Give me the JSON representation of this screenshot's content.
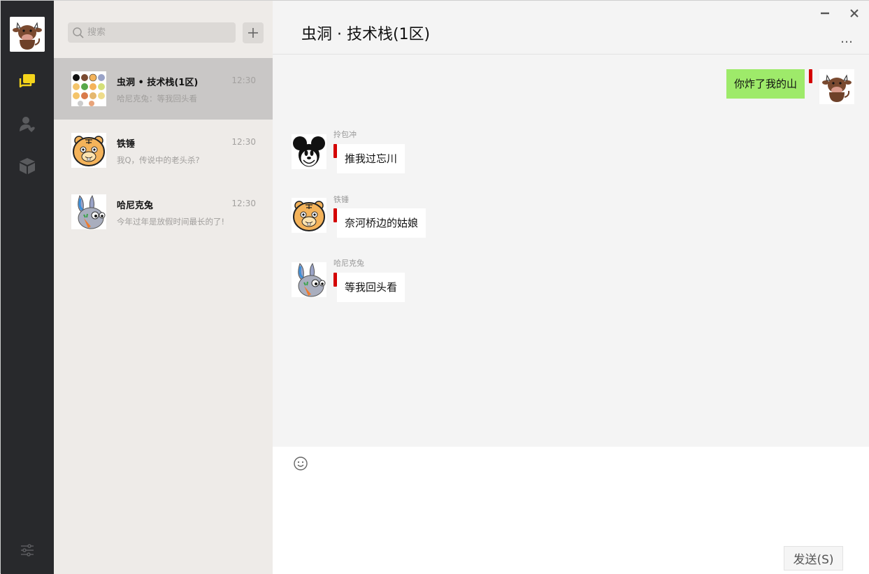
{
  "nav": {
    "user_avatar": "cow-avatar",
    "items": [
      {
        "icon": "chat-bubbles-icon",
        "active": true,
        "color": "#f4d41b"
      },
      {
        "icon": "contact-heart-icon",
        "active": false
      },
      {
        "icon": "cube-icon",
        "active": false
      }
    ],
    "settings_icon": "sliders-icon"
  },
  "search": {
    "placeholder": "搜索"
  },
  "conversations": [
    {
      "name": "虫洞 • 技术栈(1区)",
      "time": "12:30",
      "preview": "哈尼克兔：等我回头看",
      "avatar": "group-grid-avatar",
      "active": true
    },
    {
      "name": "铁锤",
      "time": "12:30",
      "preview": "我Q，传说中的老头杀?",
      "avatar": "tiger-avatar",
      "active": false
    },
    {
      "name": "哈尼克兔",
      "time": "12:30",
      "preview": "今年过年是放假时间最长的了!",
      "avatar": "rabbit-avatar",
      "active": false
    }
  ],
  "chat": {
    "title": "虫洞 · 技术栈(1区)",
    "more": "…",
    "messages": [
      {
        "mine": true,
        "text": "你炸了我的山",
        "avatar": "cow-avatar"
      },
      {
        "mine": false,
        "sender": "拎包冲",
        "text": "推我过忘川",
        "avatar": "mouse-avatar"
      },
      {
        "mine": false,
        "sender": "铁锤",
        "text": "奈河桥边的姑娘",
        "avatar": "tiger-avatar"
      },
      {
        "mine": false,
        "sender": "哈尼克兔",
        "text": "等我回头看",
        "avatar": "rabbit-avatar"
      }
    ],
    "input_value": "",
    "send_label": "发送(S)"
  },
  "colors": {
    "sidebar": "#28292c",
    "list_bg": "#eeebe8",
    "active_item": "#c9c7c6",
    "my_bubble": "#9eea6a",
    "accent": "#f4d41b",
    "mark": "#d40000"
  }
}
